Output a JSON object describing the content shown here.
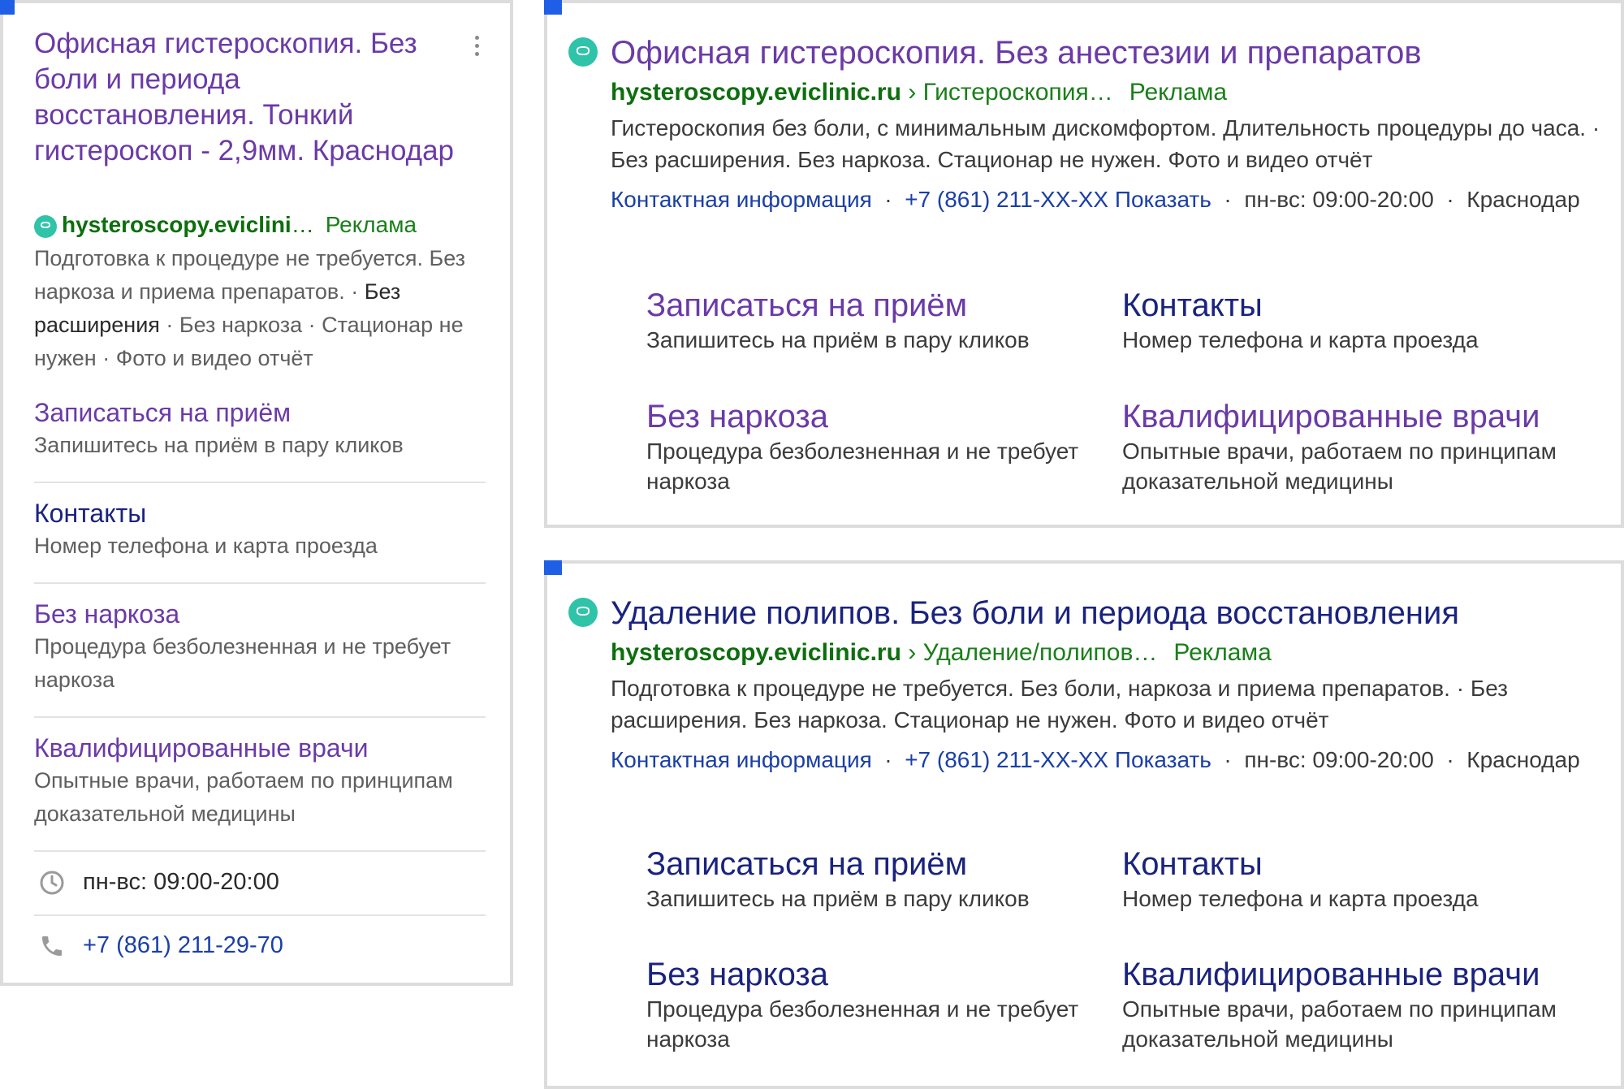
{
  "mobile_ad": {
    "title": "Офисная гистероскопия. Без боли и периода восстановления. Тонкий гистероскоп - 2,9мм. Краснодар",
    "domain": "hysteroscopy.eviclini",
    "ellipsis": "…",
    "ad_label": "Реклама",
    "desc_part1": "Подготовка к процедуре не требуется. Без наркоза и приема препаратов.",
    "desc_dot1": " · ",
    "desc_part2": "Без расширения",
    "desc_part3": " · Без наркоза · Стационар не нужен · Фото и видео отчёт",
    "sitelinks": [
      {
        "title": "Записаться на приём",
        "desc": "Запишитесь на приём в пару кликов"
      },
      {
        "title": "Контакты",
        "desc": "Номер телефона и карта проезда"
      },
      {
        "title": "Без наркоза",
        "desc": "Процедура безболезненная и не требует наркоза"
      },
      {
        "title": "Квалифицированные врачи",
        "desc": "Опытные врачи, работаем по принципам доказательной медицины"
      }
    ],
    "hours": "пн-вс: 09:00-20:00",
    "phone": "+7 (861) 211-29-70"
  },
  "desktop_ads": [
    {
      "title": "Офисная гистероскопия. Без анестезии и препаратов",
      "domain": "hysteroscopy.eviclinic.ru",
      "path": " › Гистероскопия…",
      "ad_label": "Реклама",
      "desc": "Гистероскопия без боли, с минимальным дискомфортом. Длительность процедуры до часа. · Без расширения. Без наркоза. Стационар не нужен. Фото и видео отчёт",
      "contact_label": "Контактная информация",
      "phone": "+7 (861) 211-XX-XX Показать",
      "hours": "пн-вс: 09:00-20:00",
      "city": "Краснодар",
      "sitelinks": [
        {
          "title": "Записаться на приём",
          "desc": "Запишитесь на приём в пару кликов"
        },
        {
          "title": "Контакты",
          "desc": "Номер телефона и карта проезда"
        },
        {
          "title": "Без наркоза",
          "desc": "Процедура безболезненная и не требует наркоза"
        },
        {
          "title": "Квалифицированные врачи",
          "desc": "Опытные врачи, работаем по принципам доказательной медицины"
        }
      ]
    },
    {
      "title": "Удаление полипов. Без боли и периода восстановления",
      "domain": "hysteroscopy.eviclinic.ru",
      "path": " › Удаление/полипов…",
      "ad_label": "Реклама",
      "desc": "Подготовка к процедуре не требуется. Без боли, наркоза и приема препаратов. · Без расширения. Без наркоза. Стационар не нужен. Фото и видео отчёт",
      "contact_label": "Контактная информация",
      "phone": "+7 (861) 211-XX-XX Показать",
      "hours": "пн-вс: 09:00-20:00",
      "city": "Краснодар",
      "sitelinks": [
        {
          "title": "Записаться на приём",
          "desc": "Запишитесь на приём в пару кликов"
        },
        {
          "title": "Контакты",
          "desc": "Номер телефона и карта проезда"
        },
        {
          "title": "Без наркоза",
          "desc": "Процедура безболезненная и не требует наркоза"
        },
        {
          "title": "Квалифицированные врачи",
          "desc": "Опытные врачи, работаем по принципам доказательной медицины"
        }
      ]
    }
  ],
  "colors": {
    "title_visited": "#6b3aa7",
    "title_unvisited": "#1a237e",
    "url_green": "#0d6e0d",
    "corner_marker": "#1f5fe6",
    "favicon": "#2fc3a9"
  },
  "icons": [
    "kebab-menu-icon",
    "clinic-favicon-icon",
    "clock-icon",
    "phone-icon"
  ]
}
